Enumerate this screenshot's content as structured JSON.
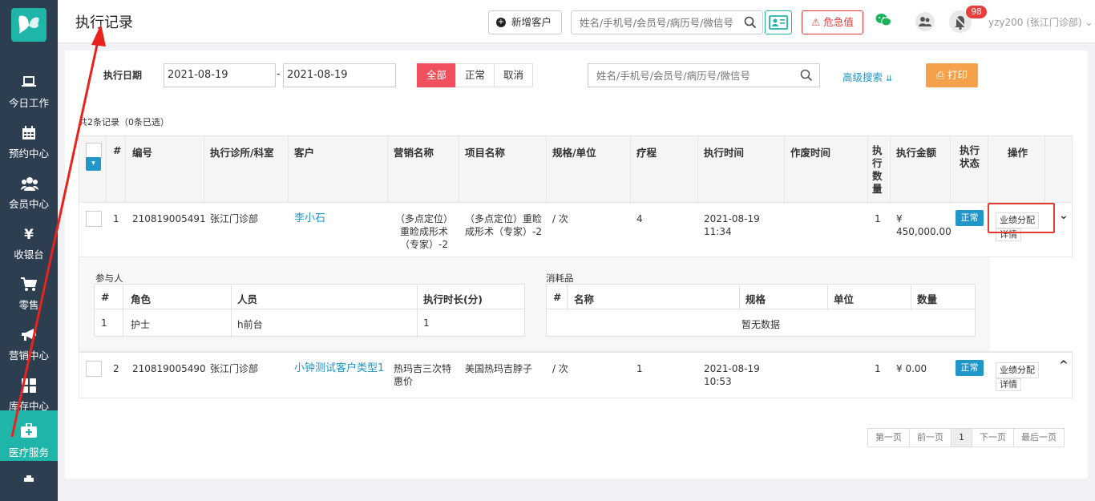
{
  "sidebar": {
    "items": [
      {
        "label": "今日工作",
        "icon": "laptop-icon"
      },
      {
        "label": "预约中心",
        "icon": "calendar-icon"
      },
      {
        "label": "会员中心",
        "icon": "users-icon"
      },
      {
        "label": "收银台",
        "icon": "yen-icon"
      },
      {
        "label": "零售",
        "icon": "cart-icon"
      },
      {
        "label": "营销中心",
        "icon": "megaphone-icon"
      },
      {
        "label": "库存中心",
        "icon": "grid-icon"
      },
      {
        "label": "医疗服务",
        "icon": "medkit-icon"
      }
    ],
    "active": "医疗服务"
  },
  "header": {
    "title": "执行记录",
    "add_customer": "新增客户",
    "search_placeholder": "姓名/手机号/会员号/病历号/微信号",
    "danger_label": "危急值",
    "notification_count": "98",
    "user": "yzy200 (张江门诊部)"
  },
  "filter": {
    "date_label": "执行日期",
    "date_from": "2021-08-19",
    "date_to": "2021-08-19",
    "dash": "-",
    "status_options": [
      "全部",
      "正常",
      "取消"
    ],
    "status_selected": "全部",
    "search_placeholder": "姓名/手机号/会员号/病历号/微信号",
    "advanced_search": "高级搜索",
    "print": "打印"
  },
  "summary": "共2条记录（0条已选）",
  "table": {
    "headers": [
      "#",
      "编号",
      "执行诊所/科室",
      "客户",
      "营销名称",
      "项目名称",
      "规格/单位",
      "疗程",
      "执行时间",
      "作废时间",
      "执行数量",
      "执行金额",
      "执行状态",
      "操作"
    ],
    "rows": [
      {
        "index": "1",
        "code": "210819005491",
        "clinic": "张江门诊部",
        "customer": "李小石",
        "marketing": "（多点定位）重睑成形术（专家）-2",
        "project": "（多点定位）重睑成形术（专家）-2",
        "spec": "/ 次",
        "course": "4",
        "exec_date": "2021-08-19",
        "exec_time": "11:34",
        "void_time": "",
        "qty": "1",
        "amount": "¥ 450,000.00",
        "status": "正常",
        "op_assign": "业绩分配",
        "op_detail": "详情"
      },
      {
        "index": "2",
        "code": "210819005490",
        "clinic": "张江门诊部",
        "customer": "小钟测试客户类型1",
        "marketing": "热玛吉三次特惠价",
        "project": "美国热玛吉脖子",
        "spec": "/ 次",
        "course": "1",
        "exec_date": "2021-08-19",
        "exec_time": "10:53",
        "void_time": "",
        "qty": "1",
        "amount": "¥ 0.00",
        "status": "正常",
        "op_assign": "业绩分配",
        "op_detail": "详情"
      }
    ]
  },
  "detail": {
    "participants_title": "参与人",
    "participants_headers": [
      "#",
      "角色",
      "人员",
      "执行时长(分)"
    ],
    "participants_rows": [
      [
        "1",
        "护士",
        "h前台",
        "1"
      ]
    ],
    "consumables_title": "消耗品",
    "consumables_headers": [
      "#",
      "名称",
      "规格",
      "单位",
      "数量"
    ],
    "consumables_empty": "暂无数据"
  },
  "pagination": [
    "第一页",
    "前一页",
    "1",
    "下一页",
    "最后一页"
  ],
  "colors": {
    "sidebar": "#2c3e50",
    "accent": "#1fb5a8",
    "danger": "#e53935",
    "link": "#2196c9",
    "print": "#f5a04b"
  }
}
